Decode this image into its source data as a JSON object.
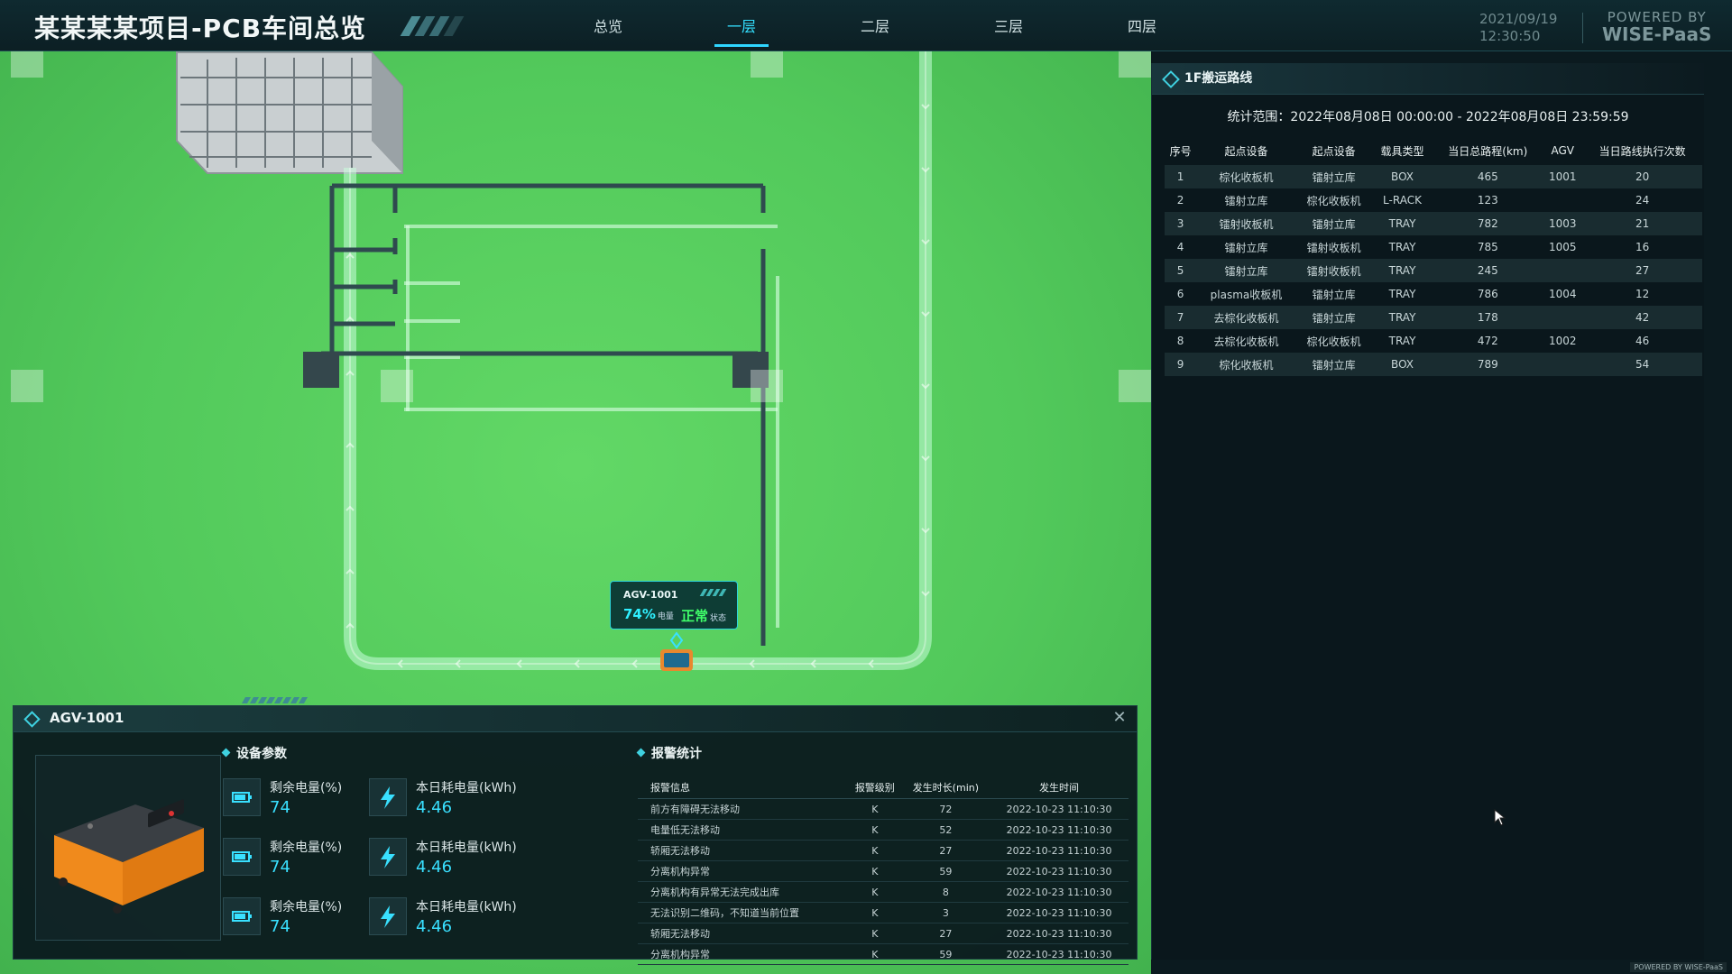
{
  "header": {
    "title": "某某某某项目-PCB车间总览",
    "tabs": [
      "总览",
      "一层",
      "二层",
      "三层",
      "四层"
    ],
    "active_tab": "一层",
    "date": "2021/09/19",
    "time": "12:30:50",
    "brand_top": "POWERED BY",
    "brand_bottom": "WISE-PaaS"
  },
  "map": {
    "agv_tooltip": {
      "name": "AGV-1001",
      "battery": "74%",
      "battery_label": "电量",
      "status": "正常",
      "status_label": "状态"
    }
  },
  "routes_panel": {
    "title": "1F搬运路线",
    "range": "统计范围：2022年08月08日 00:00:00 - 2022年08月08日 23:59:59",
    "columns": [
      "序号",
      "起点设备",
      "起点设备",
      "载具类型",
      "当日总路程(km)",
      "AGV",
      "当日路线执行次数"
    ],
    "rows": [
      [
        "1",
        "棕化收板机",
        "镭射立库",
        "BOX",
        "465",
        "1001",
        "20"
      ],
      [
        "2",
        "镭射立库",
        "棕化收板机",
        "L-RACK",
        "123",
        "",
        "24"
      ],
      [
        "3",
        "镭射收板机",
        "镭射立库",
        "TRAY",
        "782",
        "1003",
        "21"
      ],
      [
        "4",
        "镭射立库",
        "镭射收板机",
        "TRAY",
        "785",
        "1005",
        "16"
      ],
      [
        "5",
        "镭射立库",
        "镭射收板机",
        "TRAY",
        "245",
        "",
        "27"
      ],
      [
        "6",
        "plasma收板机",
        "镭射立库",
        "TRAY",
        "786",
        "1004",
        "12"
      ],
      [
        "7",
        "去棕化收板机",
        "镭射立库",
        "TRAY",
        "178",
        "",
        "42"
      ],
      [
        "8",
        "去棕化收板机",
        "棕化收板机",
        "TRAY",
        "472",
        "1002",
        "46"
      ],
      [
        "9",
        "棕化收板机",
        "镭射立库",
        "BOX",
        "789",
        "",
        "54"
      ]
    ]
  },
  "agv_panel": {
    "title": "AGV-1001",
    "params_title": "设备参数",
    "alarms_title": "报警统计",
    "params": [
      {
        "label": "剩余电量(%)",
        "value": "74"
      },
      {
        "label": "本日耗电量(kWh)",
        "value": "4.46"
      },
      {
        "label": "剩余电量(%)",
        "value": "74"
      },
      {
        "label": "本日耗电量(kWh)",
        "value": "4.46"
      },
      {
        "label": "剩余电量(%)",
        "value": "74"
      },
      {
        "label": "本日耗电量(kWh)",
        "value": "4.46"
      }
    ],
    "alarm_columns": [
      "报警信息",
      "报警级别",
      "发生时长(min)",
      "发生时间"
    ],
    "alarms": [
      [
        "前方有障碍无法移动",
        "K",
        "72",
        "2022-10-23 11:10:30"
      ],
      [
        "电量低无法移动",
        "K",
        "52",
        "2022-10-23 11:10:30"
      ],
      [
        "轿厢无法移动",
        "K",
        "27",
        "2022-10-23 11:10:30"
      ],
      [
        "分离机构异常",
        "K",
        "59",
        "2022-10-23 11:10:30"
      ],
      [
        "分离机构有异常无法完成出库",
        "K",
        "8",
        "2022-10-23 11:10:30"
      ],
      [
        "无法识别二维码，不知道当前位置",
        "K",
        "3",
        "2022-10-23 11:10:30"
      ],
      [
        "轿厢无法移动",
        "K",
        "27",
        "2022-10-23 11:10:30"
      ],
      [
        "分离机构异常",
        "K",
        "59",
        "2022-10-23 11:10:30"
      ]
    ]
  },
  "footer": "POWERED BY WISE-PaaS",
  "colors": {
    "accent": "#2fd6ff",
    "floor": "#52c95b",
    "status_ok": "#40ff6a"
  }
}
